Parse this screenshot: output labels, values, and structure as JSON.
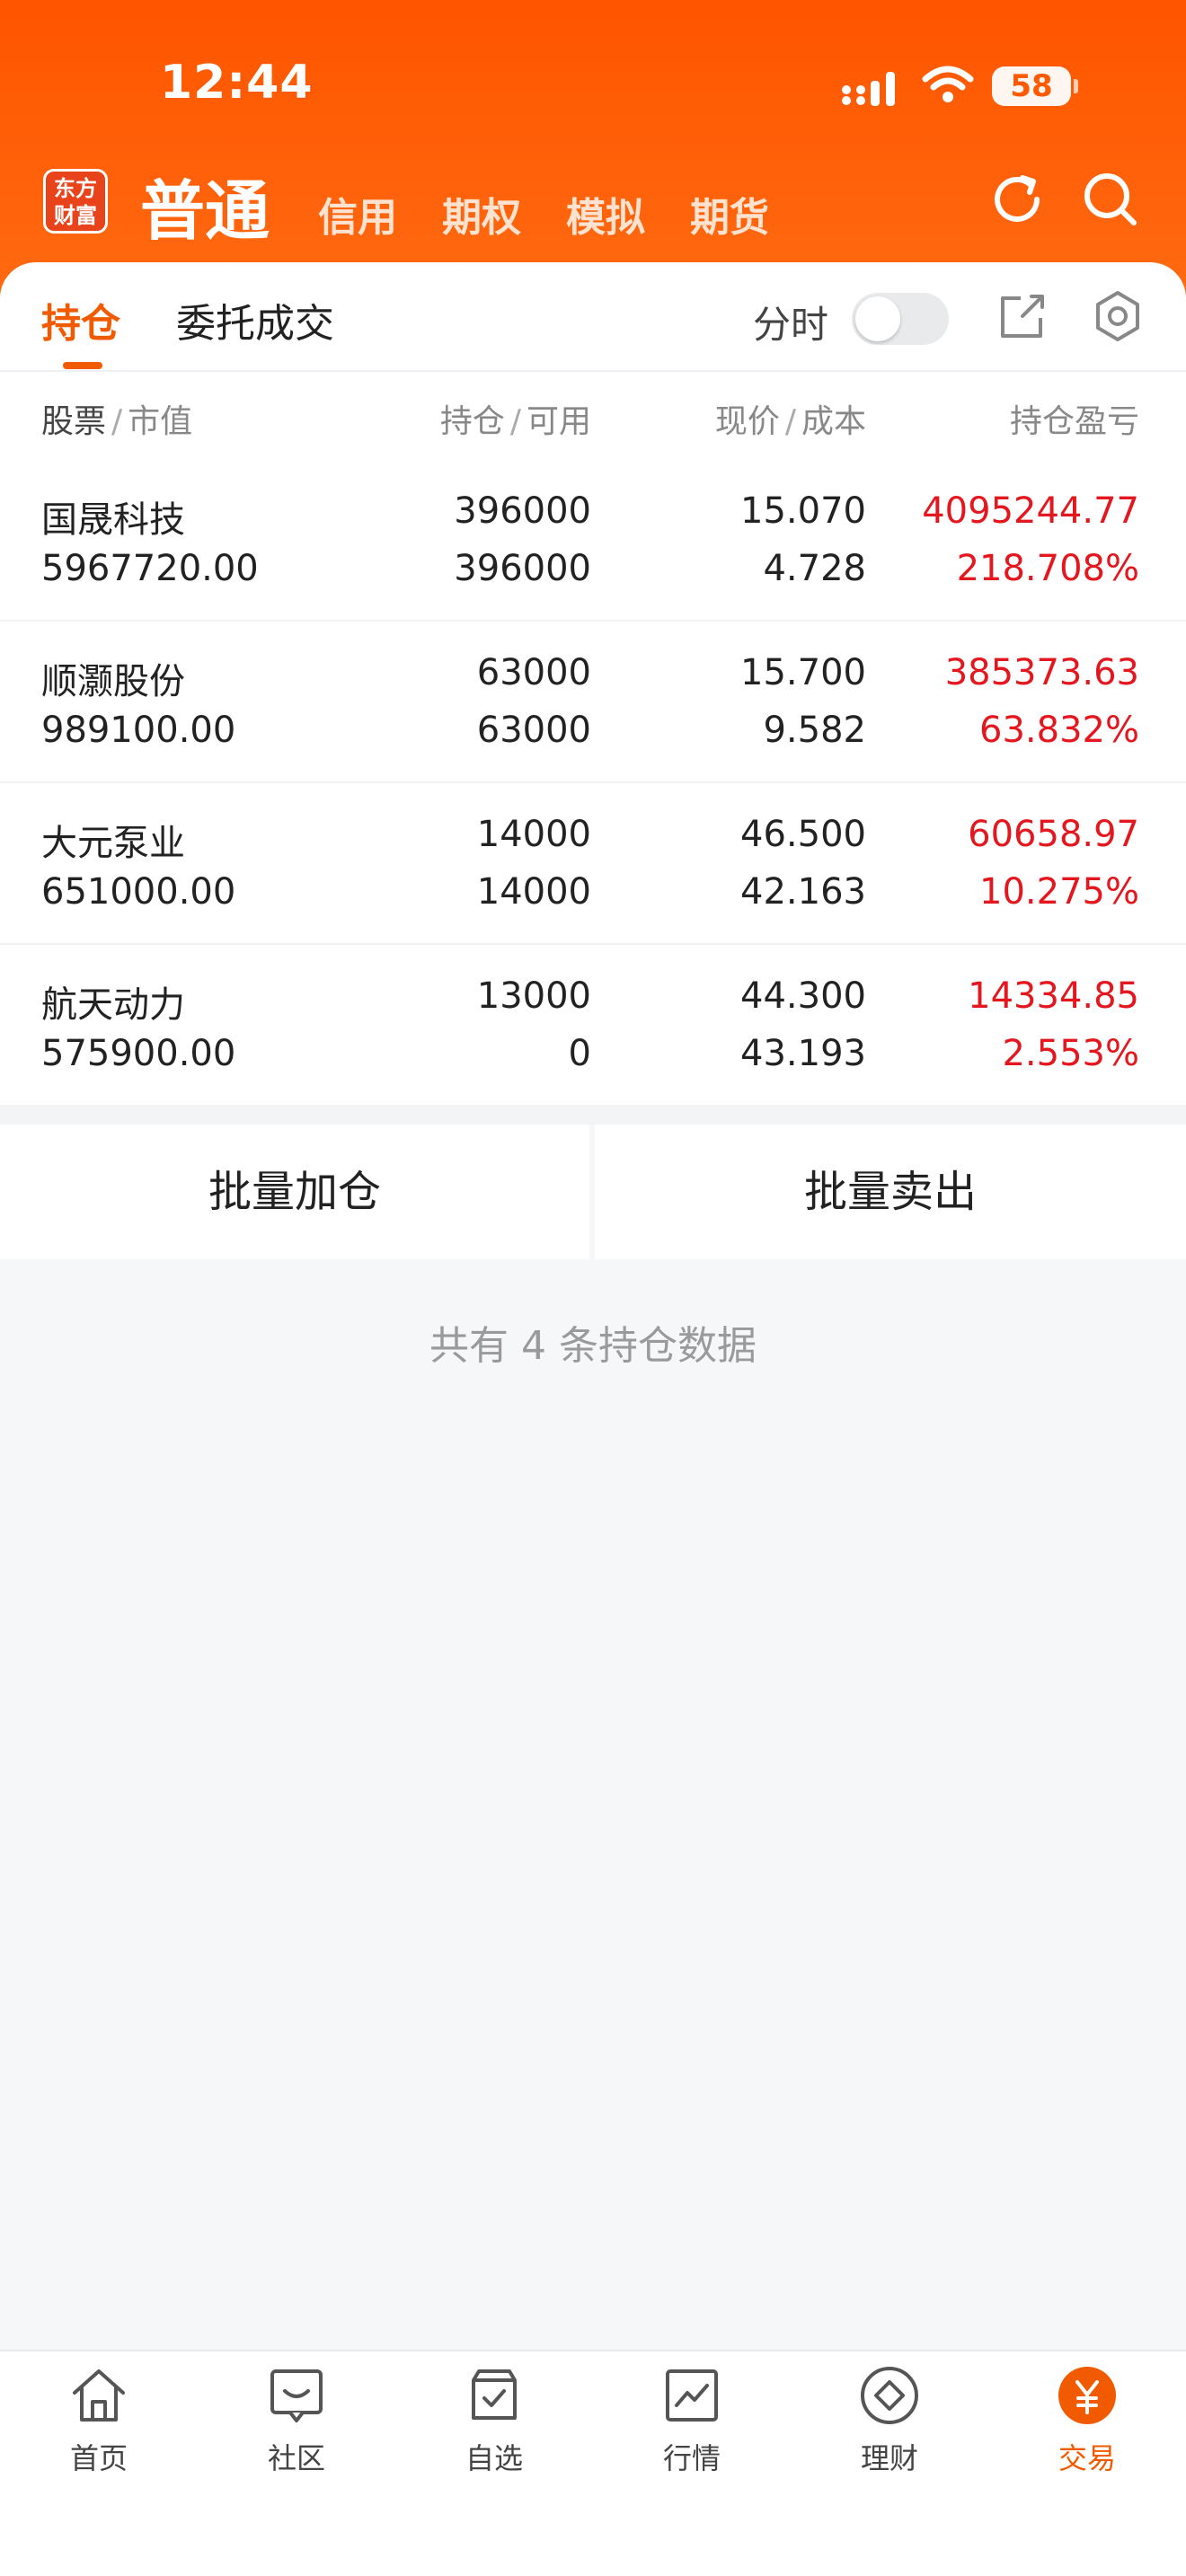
{
  "status_bar": {
    "time": "12:44",
    "battery": "58"
  },
  "header": {
    "logo_text": "东方\n财富",
    "active_tab": "普通",
    "tabs": [
      "信用",
      "期权",
      "模拟",
      "期货"
    ]
  },
  "subtabs": {
    "positions": "持仓",
    "orders": "委托成交",
    "fenshi": "分时"
  },
  "columns": {
    "c1a": "股票",
    "c1b": "市值",
    "c2a": "持仓",
    "c2b": "可用",
    "c3a": "现价",
    "c3b": "成本",
    "c4": "持仓盈亏"
  },
  "positions": [
    {
      "name": "国晟科技",
      "market_value": "5967720.00",
      "holding": "396000",
      "available": "396000",
      "price": "15.070",
      "cost": "4.728",
      "pnl": "4095244.77",
      "pnl_pct": "218.708%"
    },
    {
      "name": "顺灏股份",
      "market_value": "989100.00",
      "holding": "63000",
      "available": "63000",
      "price": "15.700",
      "cost": "9.582",
      "pnl": "385373.63",
      "pnl_pct": "63.832%"
    },
    {
      "name": "大元泵业",
      "market_value": "651000.00",
      "holding": "14000",
      "available": "14000",
      "price": "46.500",
      "cost": "42.163",
      "pnl": "60658.97",
      "pnl_pct": "10.275%"
    },
    {
      "name": "航天动力",
      "market_value": "575900.00",
      "holding": "13000",
      "available": "0",
      "price": "44.300",
      "cost": "43.193",
      "pnl": "14334.85",
      "pnl_pct": "2.553%"
    }
  ],
  "actions": {
    "batch_add": "批量加仓",
    "batch_sell": "批量卖出"
  },
  "summary": "共有 4 条持仓数据",
  "bottom_nav": [
    {
      "label": "首页",
      "icon": "home-icon"
    },
    {
      "label": "社区",
      "icon": "chat-icon"
    },
    {
      "label": "自选",
      "icon": "watchlist-icon"
    },
    {
      "label": "行情",
      "icon": "chart-icon"
    },
    {
      "label": "理财",
      "icon": "diamond-icon"
    },
    {
      "label": "交易",
      "icon": "yuan-icon"
    }
  ],
  "colors": {
    "accent": "#f25a00",
    "header": "#ff5400",
    "profit": "#e4161e"
  }
}
